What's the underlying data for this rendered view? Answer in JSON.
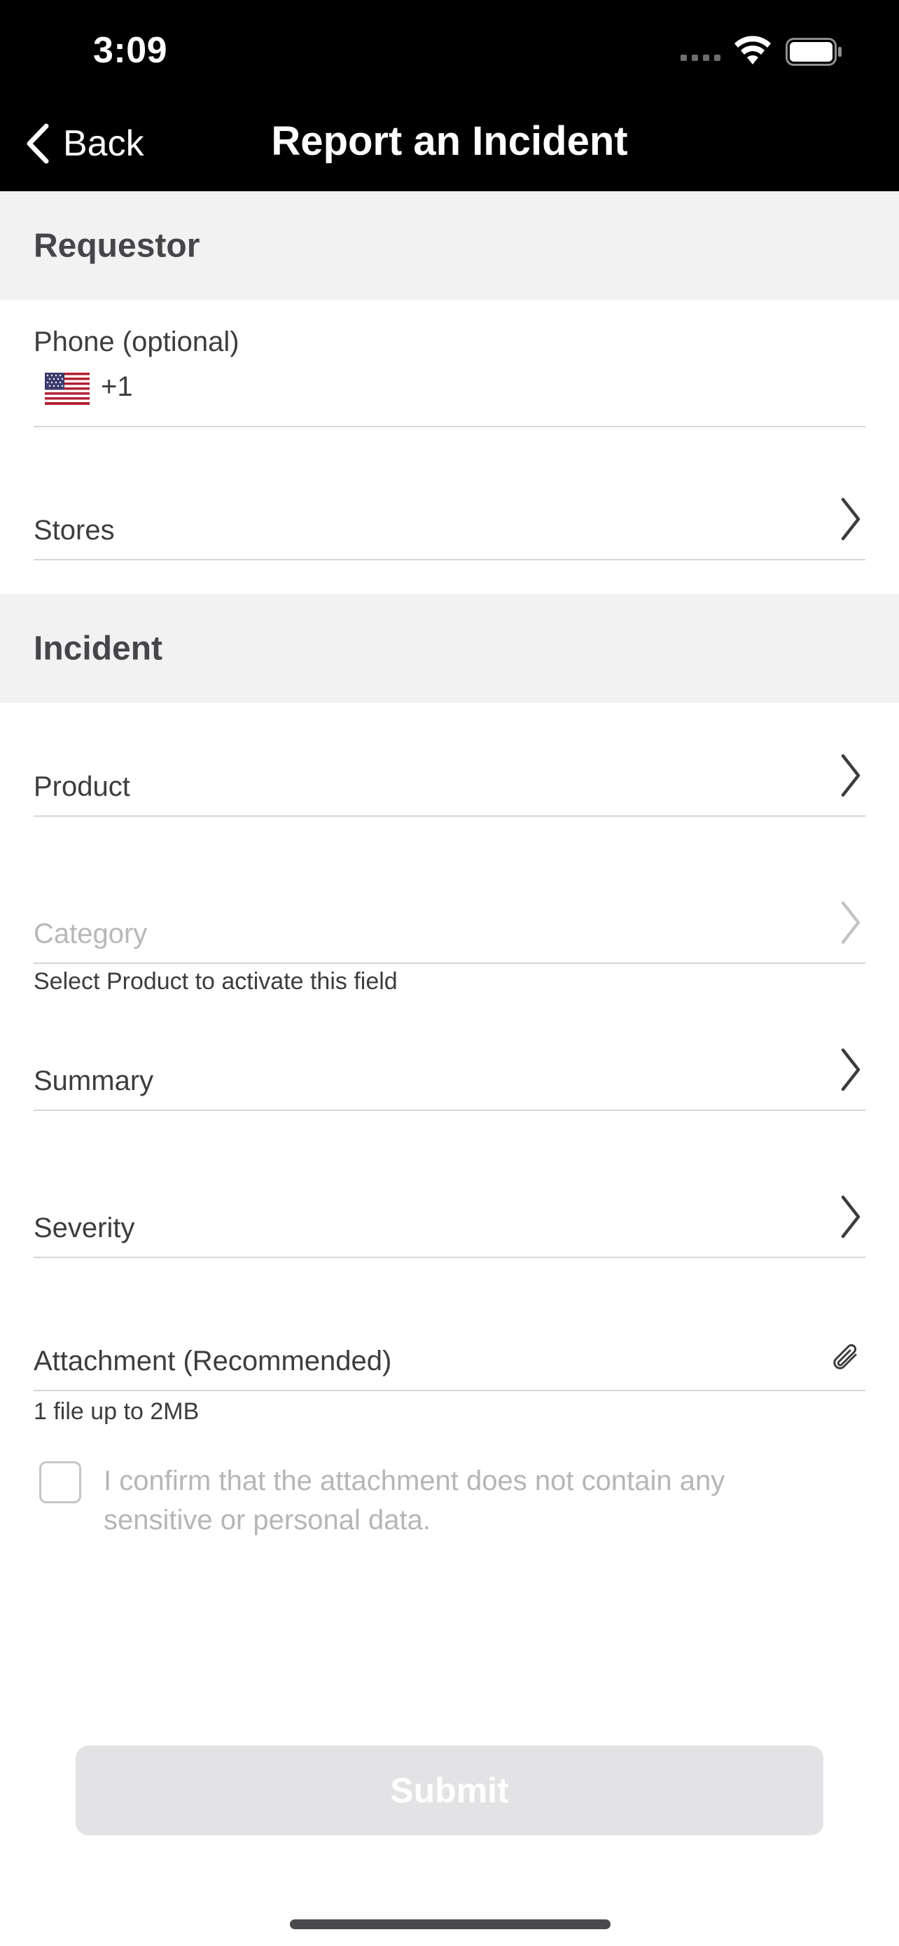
{
  "status_bar": {
    "time": "3:09"
  },
  "nav": {
    "back_label": "Back",
    "title": "Report an Incident"
  },
  "sections": {
    "requestor": "Requestor",
    "incident": "Incident"
  },
  "fields": {
    "phone_label": "Phone (optional)",
    "phone_country_code": "+1",
    "stores_label": "Stores",
    "product_label": "Product",
    "category_label": "Category",
    "category_hint": "Select Product to activate this field",
    "summary_label": "Summary",
    "severity_label": "Severity",
    "attachment_label": "Attachment (Recommended)",
    "attachment_hint": "1 file up to 2MB"
  },
  "confirm_text": "I confirm that the attachment does not contain any sensitive or personal data.",
  "submit_label": "Submit",
  "colors": {
    "nav_background": "#000000",
    "section_background": "#f2f2f2",
    "disabled_text": "#b8b8bb",
    "submit_disabled": "#e3e3e5"
  }
}
